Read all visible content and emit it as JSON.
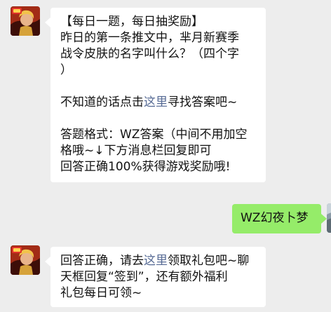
{
  "messages": [
    {
      "side": "left",
      "sender": "bot",
      "avatar_icon": "game-hero-avatar-icon",
      "line1": "【每日一题，每日抽奖励】",
      "line2": "昨日的第一条推文中，芈月新赛季",
      "line3": "战令皮肤的名字叫什么？（四个字",
      "line4": "）",
      "line5_pre": "不知道的话点击",
      "line5_link": "这里",
      "line5_post": "寻找答案吧~",
      "line6": "答题格式：WZ答案（中间不用加空",
      "line7": "格哦~↓下方消息栏回复即可",
      "line8": "回答正确100%获得游戏奖励哦!"
    },
    {
      "side": "right",
      "sender": "user",
      "avatar_icon": "user-photo-avatar-icon",
      "text": "WZ幻夜卜梦"
    },
    {
      "side": "left",
      "sender": "bot",
      "avatar_icon": "game-hero-avatar-icon",
      "line1_pre": "回答正确，请去",
      "line1_link": "这里",
      "line1_post": "领取礼包吧~聊",
      "line2": "天框回复“签到”，还有额外福利",
      "line3": "礼包每日可领~"
    }
  ],
  "colors": {
    "background": "#ededed",
    "bubble_left": "#ffffff",
    "bubble_right": "#95ec69",
    "link": "#576b95"
  }
}
